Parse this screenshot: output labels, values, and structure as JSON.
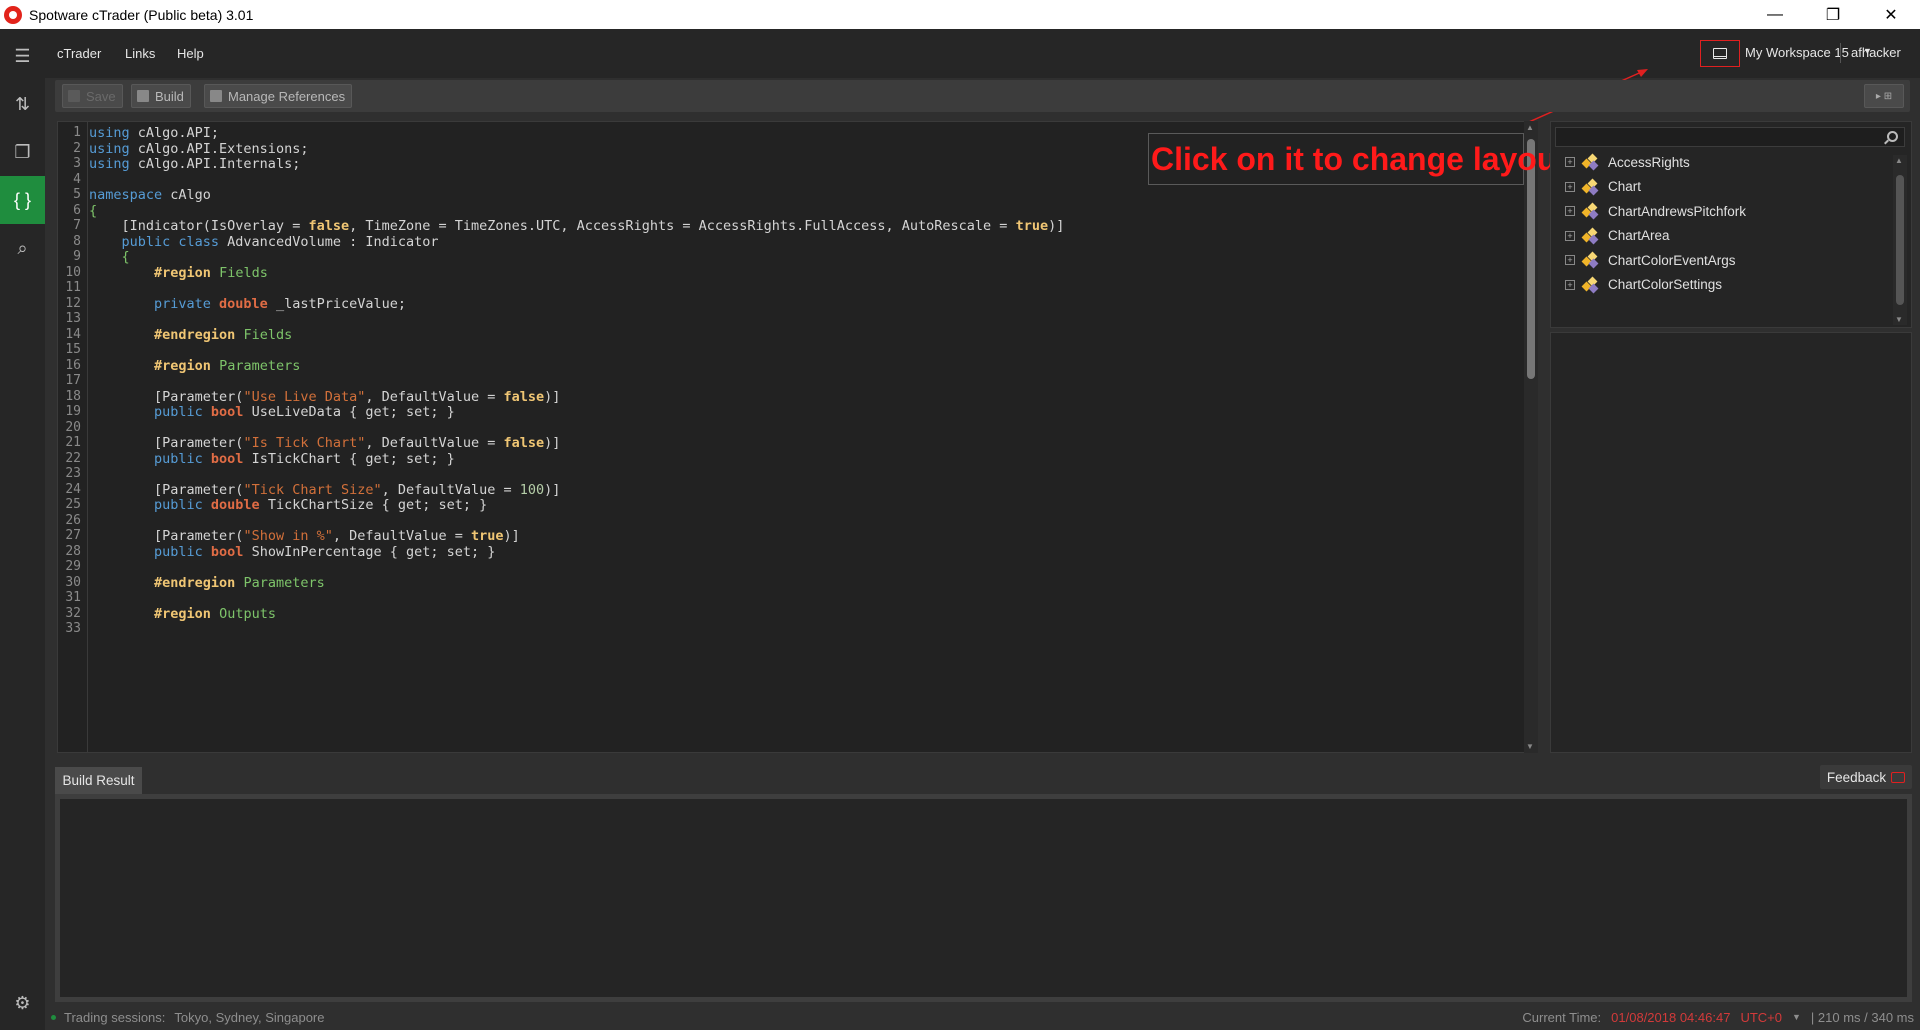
{
  "window": {
    "title": "Spotware cTrader (Public beta) 3.01",
    "controls": [
      "—",
      "❐",
      "✕"
    ]
  },
  "rail": {
    "items": [
      {
        "name": "menu-icon",
        "glyph": "☰"
      },
      {
        "name": "trade-icon",
        "glyph": "⇅"
      },
      {
        "name": "copy-icon",
        "glyph": "❐"
      },
      {
        "name": "automate-icon",
        "glyph": "{ }"
      },
      {
        "name": "analyze-icon",
        "glyph": "⌕"
      }
    ],
    "settings_glyph": "⚙"
  },
  "menu": {
    "items": [
      "cTrader",
      "Links",
      "Help"
    ],
    "workspace": "My Workspace 15",
    "workspace_caret": "▼",
    "user": "afhacker"
  },
  "toolbar": {
    "save_label": "Save",
    "build_label": "Build",
    "manage_refs_label": "Manage References",
    "right_glyph": "▸ ⊞"
  },
  "annotation": {
    "text": "Click on it to change layout",
    "color": "#ff1a1a"
  },
  "editor": {
    "lines": [
      [
        {
          "t": "using",
          "c": "kw"
        },
        {
          "t": " cAlgo.API;",
          "c": ""
        }
      ],
      [
        {
          "t": "using",
          "c": "kw"
        },
        {
          "t": " cAlgo.API.Extensions;",
          "c": ""
        }
      ],
      [
        {
          "t": "using",
          "c": "kw"
        },
        {
          "t": " cAlgo.API.Internals;",
          "c": ""
        }
      ],
      [],
      [
        {
          "t": "namespace",
          "c": "kw"
        },
        {
          "t": " cAlgo",
          "c": ""
        }
      ],
      [
        {
          "t": "{",
          "c": "reg"
        }
      ],
      [
        {
          "t": "    [Indicator(IsOverlay = ",
          "c": ""
        },
        {
          "t": "false",
          "c": "lit"
        },
        {
          "t": ", TimeZone = TimeZones.UTC, AccessRights = AccessRights.FullAccess, AutoRescale = ",
          "c": ""
        },
        {
          "t": "true",
          "c": "lit"
        },
        {
          "t": ")]",
          "c": ""
        }
      ],
      [
        {
          "t": "    public class",
          "c": "kw"
        },
        {
          "t": " AdvancedVolume : Indicator",
          "c": ""
        }
      ],
      [
        {
          "t": "    {",
          "c": "reg"
        }
      ],
      [
        {
          "t": "        ",
          "c": ""
        },
        {
          "t": "#region",
          "c": "lit"
        },
        {
          "t": " Fields",
          "c": "reg"
        }
      ],
      [],
      [
        {
          "t": "        private ",
          "c": "kw"
        },
        {
          "t": "double",
          "c": "kb"
        },
        {
          "t": " _lastPriceValue;",
          "c": ""
        }
      ],
      [],
      [
        {
          "t": "        ",
          "c": ""
        },
        {
          "t": "#endregion",
          "c": "lit"
        },
        {
          "t": " Fields",
          "c": "reg"
        }
      ],
      [],
      [
        {
          "t": "        ",
          "c": ""
        },
        {
          "t": "#region",
          "c": "lit"
        },
        {
          "t": " Parameters",
          "c": "reg"
        }
      ],
      [],
      [
        {
          "t": "        [Parameter(",
          "c": ""
        },
        {
          "t": "\"Use Live Data\"",
          "c": "str"
        },
        {
          "t": ", DefaultValue = ",
          "c": ""
        },
        {
          "t": "false",
          "c": "lit"
        },
        {
          "t": ")]",
          "c": ""
        }
      ],
      [
        {
          "t": "        public ",
          "c": "kw"
        },
        {
          "t": "bool",
          "c": "kb"
        },
        {
          "t": " UseLiveData { get; set; }",
          "c": ""
        }
      ],
      [],
      [
        {
          "t": "        [Parameter(",
          "c": ""
        },
        {
          "t": "\"Is Tick Chart\"",
          "c": "str"
        },
        {
          "t": ", DefaultValue = ",
          "c": ""
        },
        {
          "t": "false",
          "c": "lit"
        },
        {
          "t": ")]",
          "c": ""
        }
      ],
      [
        {
          "t": "        public ",
          "c": "kw"
        },
        {
          "t": "bool",
          "c": "kb"
        },
        {
          "t": " IsTickChart { get; set; }",
          "c": ""
        }
      ],
      [],
      [
        {
          "t": "        [Parameter(",
          "c": ""
        },
        {
          "t": "\"Tick Chart Size\"",
          "c": "str"
        },
        {
          "t": ", DefaultValue = ",
          "c": ""
        },
        {
          "t": "100",
          "c": "num"
        },
        {
          "t": ")]",
          "c": ""
        }
      ],
      [
        {
          "t": "        public ",
          "c": "kw"
        },
        {
          "t": "double",
          "c": "kb"
        },
        {
          "t": " TickChartSize { get; set; }",
          "c": ""
        }
      ],
      [],
      [
        {
          "t": "        [Parameter(",
          "c": ""
        },
        {
          "t": "\"Show in %\"",
          "c": "str"
        },
        {
          "t": ", DefaultValue = ",
          "c": ""
        },
        {
          "t": "true",
          "c": "lit"
        },
        {
          "t": ")]",
          "c": ""
        }
      ],
      [
        {
          "t": "        public ",
          "c": "kw"
        },
        {
          "t": "bool",
          "c": "kb"
        },
        {
          "t": " ShowInPercentage { get; set; }",
          "c": ""
        }
      ],
      [],
      [
        {
          "t": "        ",
          "c": ""
        },
        {
          "t": "#endregion",
          "c": "lit"
        },
        {
          "t": " Parameters",
          "c": "reg"
        }
      ],
      [],
      [
        {
          "t": "        ",
          "c": ""
        },
        {
          "t": "#region",
          "c": "lit"
        },
        {
          "t": " Outputs",
          "c": "reg"
        }
      ],
      []
    ]
  },
  "references": {
    "search_value": "",
    "items": [
      "AccessRights",
      "Chart",
      "ChartAndrewsPitchfork",
      "ChartArea",
      "ChartColorEventArgs",
      "ChartColorSettings"
    ],
    "expand_glyph": "+"
  },
  "bottom": {
    "tab_label": "Build Result",
    "feedback_label": "Feedback"
  },
  "status": {
    "sessions_label": "Trading sessions:",
    "sessions_value": "Tokyo, Sydney, Singapore",
    "time_label": "Current Time:",
    "time_value": "01/08/2018 04:46:47",
    "timezone": "UTC+0",
    "tz_caret": "▼",
    "latency": "| 210 ms / 340 ms"
  }
}
